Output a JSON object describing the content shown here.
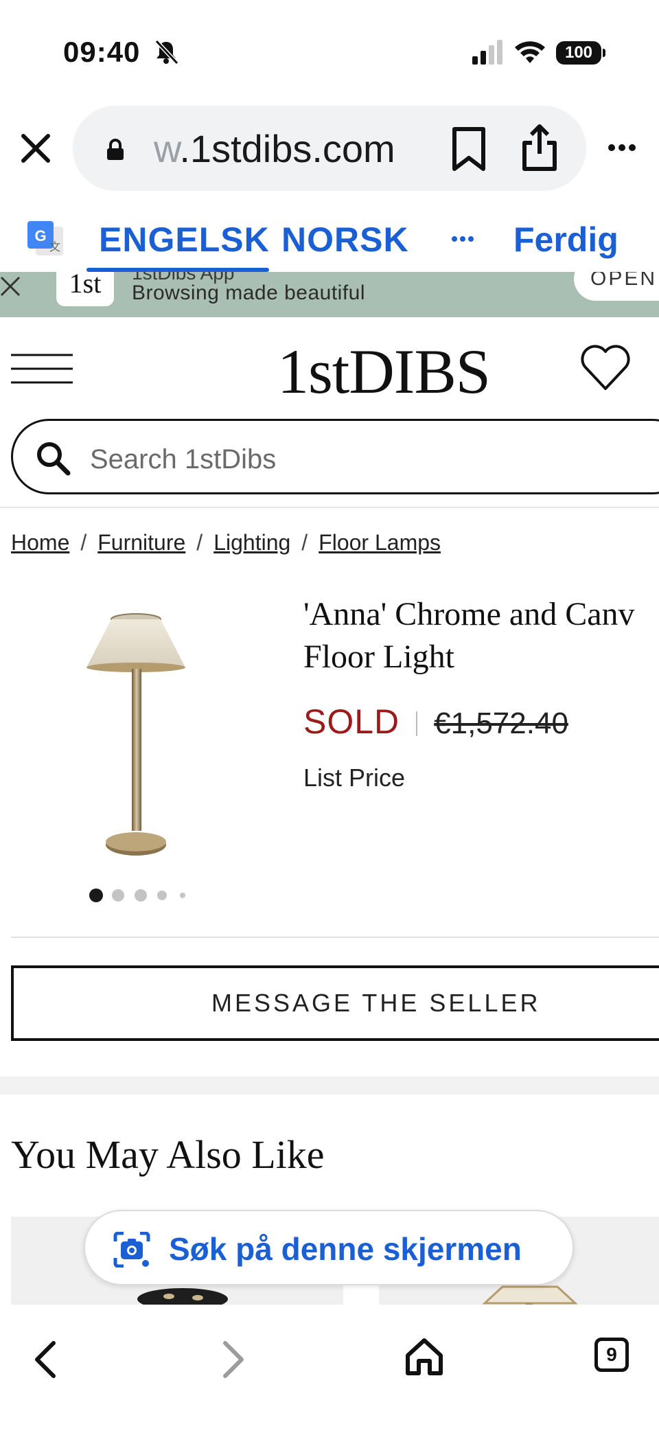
{
  "status_bar": {
    "time": "09:40",
    "battery": "100"
  },
  "browser": {
    "url_fade": "w",
    "url_main": ".1stdibs.com",
    "icons": [
      "close-icon",
      "lock-icon",
      "bookmark-icon",
      "share-icon",
      "more-icon"
    ]
  },
  "translate": {
    "source_lang": "ENGELSK",
    "target_lang": "NORSK",
    "done_label": "Ferdig",
    "accent_color": "#1a5fd4"
  },
  "app_banner": {
    "logo_text": "1st",
    "title": "1stDibs App",
    "subtitle": "Browsing made beautiful",
    "open_label": "OPEN",
    "background_color": "#a9bfb3"
  },
  "header": {
    "logo": "1stDIBS"
  },
  "search": {
    "placeholder": "Search 1stDibs"
  },
  "breadcrumb": {
    "items": [
      "Home",
      "Furniture",
      "Lighting",
      "Floor Lamps"
    ],
    "separator": "/"
  },
  "product": {
    "title_line1": "'Anna' Chrome and Canv",
    "title_line2": "Floor Light",
    "status": "SOLD",
    "status_color": "#9b1b1b",
    "original_price": "€1,572.40",
    "price_note": "List Price",
    "image_count": 5,
    "active_image": 1
  },
  "actions": {
    "message_seller": "MESSAGE THE SELLER"
  },
  "recommendations": {
    "heading": "You May Also Like"
  },
  "lens": {
    "label": "Søk på denne skjermen"
  },
  "bottom_nav": {
    "tab_count": "9"
  }
}
